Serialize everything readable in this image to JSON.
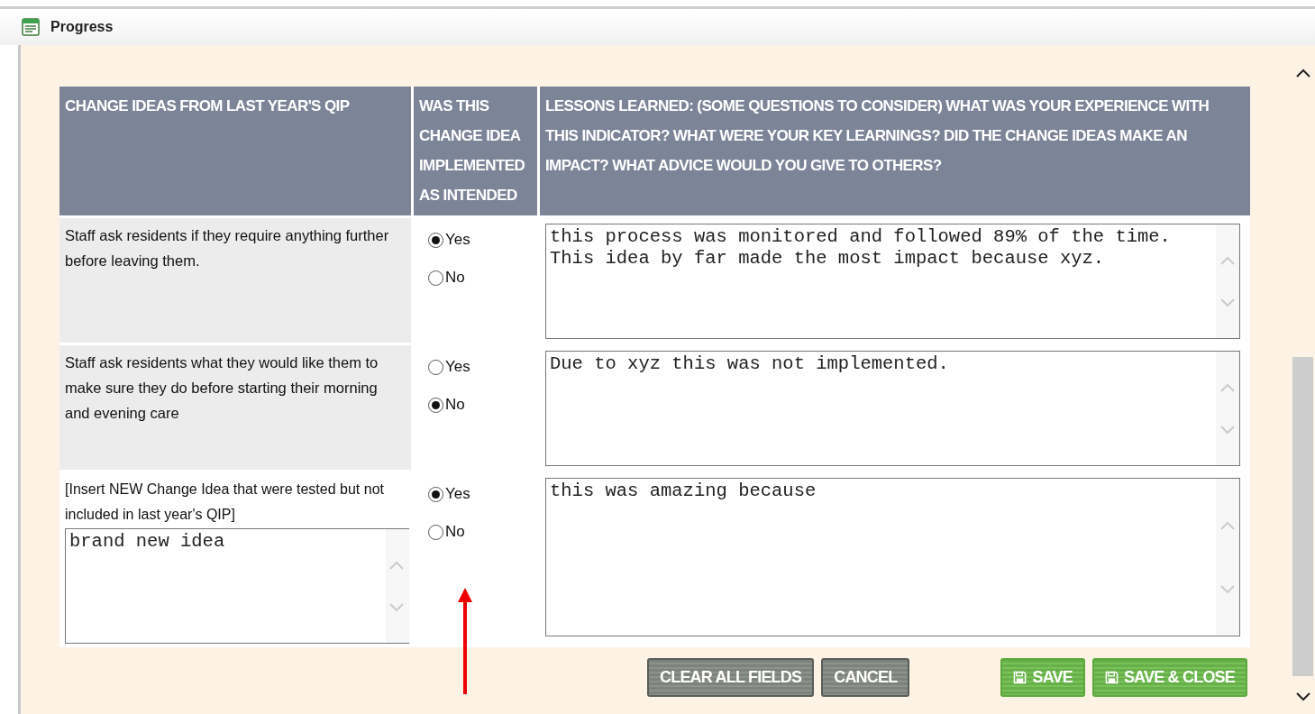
{
  "window": {
    "title": "Progress"
  },
  "table": {
    "columns": [
      "CHANGE IDEAS FROM LAST YEAR'S QIP",
      "WAS THIS CHANGE IDEA IMPLEMENTED AS INTENDED",
      "LESSONS LEARNED: (SOME QUESTIONS TO CONSIDER) WHAT WAS YOUR EXPERIENCE WITH THIS INDICATOR? WHAT WERE YOUR KEY LEARNINGS? DID THE CHANGE IDEAS MAKE AN IMPACT? WHAT ADVICE WOULD YOU GIVE TO OTHERS?"
    ],
    "rows": [
      {
        "kind": "listed",
        "idea": "Staff ask residents if they require anything further before leaving them.",
        "options": [
          {
            "label": "Yes",
            "selected": true
          },
          {
            "label": "No",
            "selected": false
          }
        ],
        "lessons": "this process was monitored and followed 89% of the time.\nThis idea by far made the most impact because xyz."
      },
      {
        "kind": "listed",
        "idea": "Staff ask residents what they would like them to make sure they do before starting their morning and evening care",
        "options": [
          {
            "label": "Yes",
            "selected": false
          },
          {
            "label": "No",
            "selected": true
          }
        ],
        "lessons": "Due to xyz this was not implemented."
      },
      {
        "kind": "new",
        "idea": "[Insert NEW Change Idea that were tested but not included in last year's QIP]",
        "idea_value": "brand new idea",
        "options": [
          {
            "label": "Yes",
            "selected": true
          },
          {
            "label": "No",
            "selected": false
          }
        ],
        "lessons": "this was amazing because"
      }
    ]
  },
  "buttons": [
    {
      "label": "CLEAR ALL FIELDS",
      "kind": "secondary"
    },
    {
      "label": "CANCEL",
      "kind": "secondary"
    },
    {
      "label": "SAVE",
      "kind": "primary"
    },
    {
      "label": "SAVE & CLOSE",
      "kind": "primary"
    }
  ]
}
